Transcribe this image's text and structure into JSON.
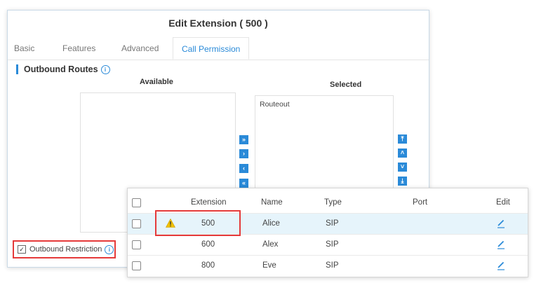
{
  "dialog": {
    "title": "Edit Extension ( 500 )",
    "tabs": [
      {
        "label": "Basic"
      },
      {
        "label": "Features"
      },
      {
        "label": "Advanced"
      },
      {
        "label": "Call Permission",
        "active": true
      }
    ]
  },
  "outbound": {
    "title": "Outbound Routes",
    "available_label": "Available",
    "selected_label": "Selected",
    "available_items": [],
    "selected_items": [
      "Routeout"
    ]
  },
  "transfer_buttons": [
    {
      "icon": "move-all-right-icon",
      "glyph": "»"
    },
    {
      "icon": "move-right-icon",
      "glyph": "›"
    },
    {
      "icon": "move-left-icon",
      "glyph": "‹"
    },
    {
      "icon": "move-all-left-icon",
      "glyph": "«"
    }
  ],
  "order_buttons": [
    {
      "icon": "move-top-icon",
      "glyph": "⤒"
    },
    {
      "icon": "move-up-icon",
      "glyph": "˄"
    },
    {
      "icon": "move-down-icon",
      "glyph": "˅"
    },
    {
      "icon": "move-bottom-icon",
      "glyph": "⤓"
    }
  ],
  "restriction": {
    "label": "Outbound Restriction",
    "checked": true
  },
  "table": {
    "columns": [
      "Extension",
      "Name",
      "Type",
      "Port",
      "Edit"
    ],
    "rows": [
      {
        "extension": "500",
        "name": "Alice",
        "type": "SIP",
        "port": "",
        "warning": true
      },
      {
        "extension": "600",
        "name": "Alex",
        "type": "SIP",
        "port": ""
      },
      {
        "extension": "800",
        "name": "Eve",
        "type": "SIP",
        "port": ""
      }
    ]
  },
  "colors": {
    "accent": "#2a8ad8",
    "highlight": "#e53a3a",
    "row_selected": "#e6f4fb",
    "warning": "#f2c200"
  }
}
